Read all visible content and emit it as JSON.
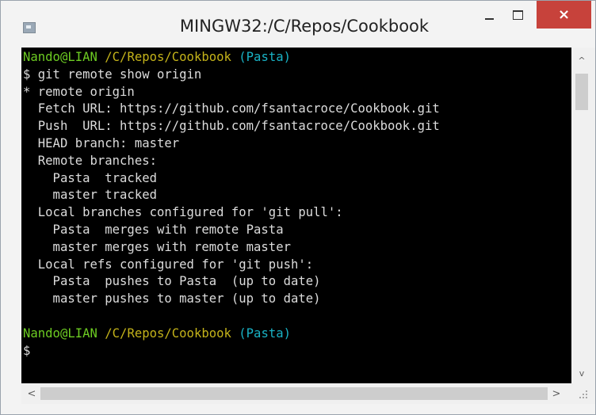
{
  "window": {
    "title": "MINGW32:/C/Repos/Cookbook",
    "controls": {
      "minimize": "minimize",
      "maximize": "maximize",
      "close": "×"
    }
  },
  "terminal": {
    "prompt1": {
      "user": "Nando@LIAN",
      "path": "/C/Repos/Cookbook",
      "branch": "(Pasta)"
    },
    "command": "$ git remote show origin",
    "output": [
      "* remote origin",
      "  Fetch URL: https://github.com/fsantacroce/Cookbook.git",
      "  Push  URL: https://github.com/fsantacroce/Cookbook.git",
      "  HEAD branch: master",
      "  Remote branches:",
      "    Pasta  tracked",
      "    master tracked",
      "  Local branches configured for 'git pull':",
      "    Pasta  merges with remote Pasta",
      "    master merges with remote master",
      "  Local refs configured for 'git push':",
      "    Pasta  pushes to Pasta  (up to date)",
      "    master pushes to master (up to date)"
    ],
    "blank": "",
    "prompt2": {
      "user": "Nando@LIAN",
      "path": "/C/Repos/Cookbook",
      "branch": "(Pasta)"
    },
    "cursor_line": "$"
  },
  "scrollbars": {
    "up_arrow": "^",
    "down_arrow": "v",
    "left_arrow": "<",
    "right_arrow": ">"
  }
}
